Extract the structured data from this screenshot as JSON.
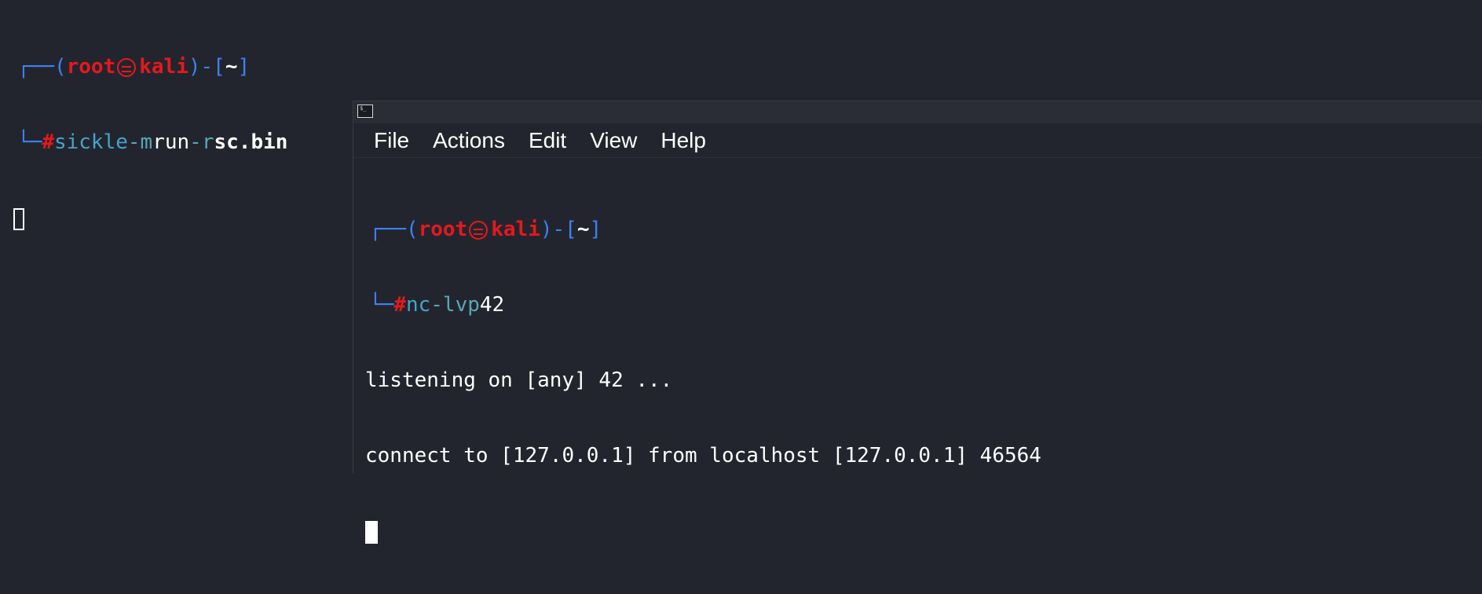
{
  "background_terminal": {
    "prompt": {
      "box_top": "┌──(",
      "user": "root",
      "host": "kali",
      "box_mid": ")-[",
      "dir": "~",
      "box_end": "]",
      "box_bottom": "└─",
      "hash": "#"
    },
    "command": {
      "program": "sickle",
      "flag_m": "-m",
      "arg_m": "run",
      "flag_r": "-r",
      "arg_r": "sc.bin"
    }
  },
  "front_window": {
    "app_icon_text": "$_",
    "menu": [
      "File",
      "Actions",
      "Edit",
      "View",
      "Help"
    ],
    "prompt": {
      "box_top": "┌──(",
      "user": "root",
      "host": "kali",
      "box_mid": ")-[",
      "dir": "~",
      "box_end": "]",
      "box_bottom": "└─",
      "hash": "#"
    },
    "command": {
      "program": "nc",
      "flags": "-lvp",
      "port": "42"
    },
    "output": [
      "listening on [any] 42 ...",
      "connect to [127.0.0.1] from localhost [127.0.0.1] 46564"
    ]
  },
  "colors": {
    "background": "#23252e",
    "prompt_blue": "#3b82f6",
    "prompt_red": "#e5191c",
    "command_cyan": "#44a3c7"
  }
}
